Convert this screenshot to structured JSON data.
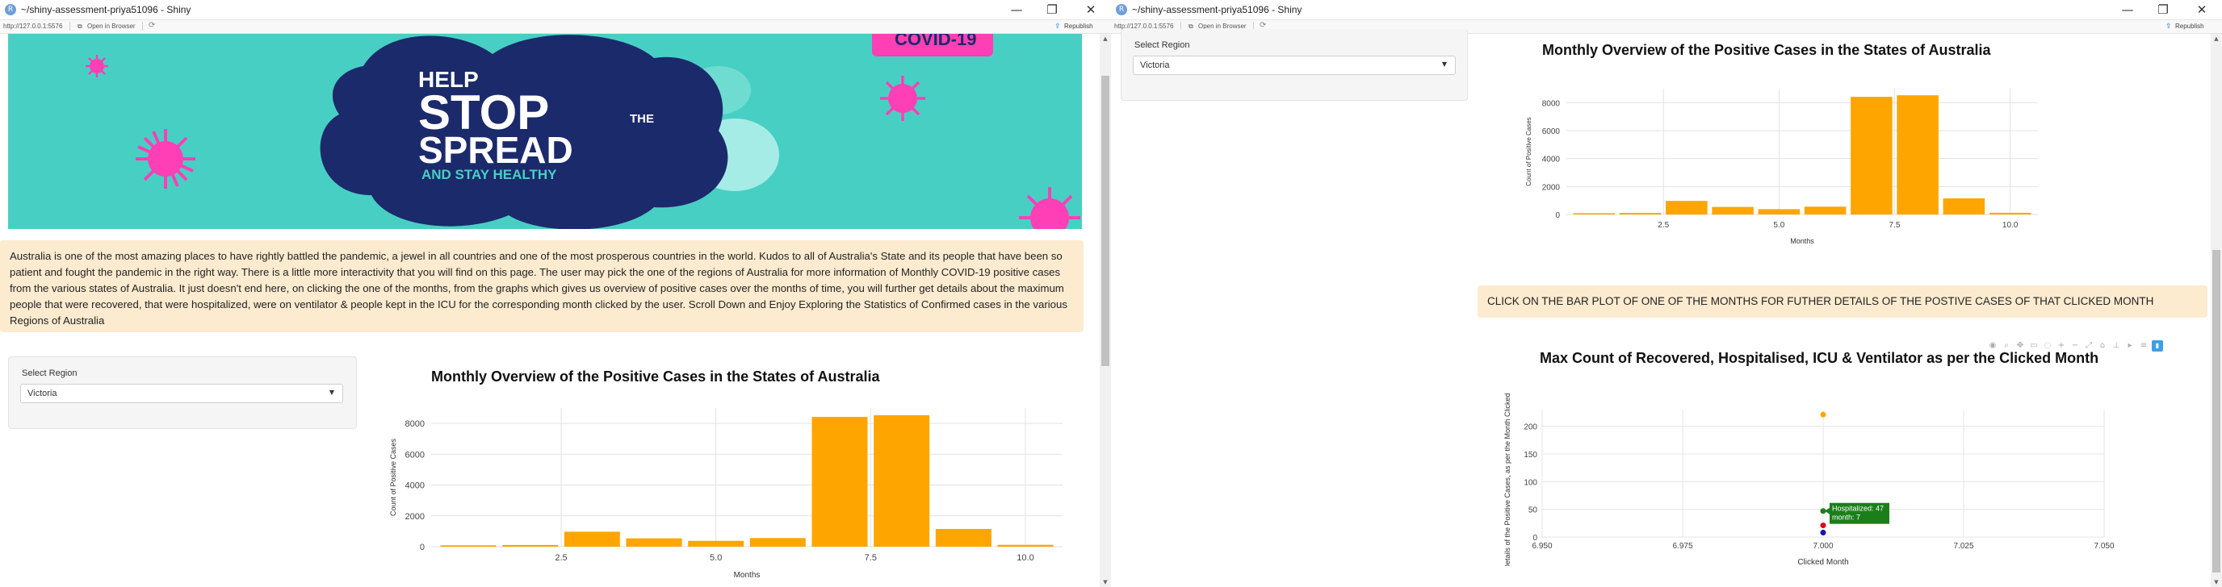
{
  "window": {
    "title": "~/shiny-assessment-priya51096 - Shiny",
    "url": "http://127.0.0.1:5576",
    "open_in_browser": "Open in Browser",
    "republish": "Republish",
    "minimize": "—",
    "maximize": "❐",
    "close": "✕"
  },
  "banner": {
    "line1": "HELP",
    "line2": "STOP",
    "the": "THE",
    "line3": "SPREAD",
    "line4": "AND STAY HEALTHY",
    "corner_text": "COVID-19",
    "bg_color": "#48cfc4",
    "blob_color": "#1b2a6b",
    "virus_color": "#ff3fb5"
  },
  "description": "Australia is one of the most amazing places to have rightly battled the pandemic, a jewel in all countries and one of the most prosperous countries in the world. Kudos to all of Australia's State and its people that have been so patient and fought the pandemic in the right way. There is a little more interactivity that you will find on this page. The user may pick the one of the regions of Australia for more information of Monthly COVID-19 positive cases from the various states of Australia. It just doesn't end here, on clicking the one of the months, from the graphs which gives us overview of positive cases over the months of time, you will further get details about the maximum people that were recovered, that were hospitalized, were on ventilator & people kept in the ICU for the corresponding month clicked by the user. Scroll Down and Enjoy Exploring the Statistics of Confirmed cases in the various Regions of Australia",
  "region_select": {
    "label": "Select Region",
    "value": "Victoria"
  },
  "click_instruction": "CLICK ON THE BAR PLOT OF ONE OF THE MONTHS FOR FUTHER DETAILS OF THE POSTIVE CASES OF THAT CLICKED MONTH",
  "modebar_icons": [
    "camera-icon",
    "zoom-icon",
    "pan-icon",
    "box-select-icon",
    "lasso-icon",
    "zoom-in-icon",
    "zoom-out-icon",
    "autoscale-icon",
    "reset-axes-icon",
    "spike-icon",
    "hover-closest-icon",
    "hover-compare-icon",
    "plotly-logo-icon"
  ],
  "tooltip": {
    "line1": "Hospitalized: 47",
    "line2": "month: 7"
  },
  "chart_data": [
    {
      "type": "bar",
      "title": "Monthly Overview of the Positive Cases in the States of Australia",
      "xlabel": "Months",
      "ylabel": "Count of Positive Cases",
      "x": [
        1,
        2,
        3,
        4,
        5,
        6,
        7,
        8,
        9,
        10
      ],
      "values": [
        90,
        110,
        970,
        540,
        380,
        560,
        8420,
        8530,
        1150,
        120
      ],
      "xlim": [
        0.4,
        10.6
      ],
      "ylim": [
        0,
        9000
      ],
      "xticks": [
        "2.5",
        "5.0",
        "7.5",
        "10.0"
      ],
      "xtick_values": [
        2.5,
        5.0,
        7.5,
        10.0
      ],
      "yticks": [
        "0",
        "2000",
        "4000",
        "6000",
        "8000"
      ],
      "ytick_values": [
        0,
        2000,
        4000,
        6000,
        8000
      ],
      "bar_color": "#ffa500",
      "grid": true
    },
    {
      "type": "scatter",
      "title": "Max Count of Recovered, Hospitalised, ICU & Ventilator as per the Clicked Month",
      "xlabel": "Clicked Month",
      "ylabel": "Details of the Positive Cases, as per the Month Clicked",
      "xlim": [
        6.95,
        7.05
      ],
      "ylim": [
        0,
        230
      ],
      "xticks": [
        "6.950",
        "6.975",
        "7.000",
        "7.025",
        "7.050"
      ],
      "xtick_values": [
        6.95,
        6.975,
        7.0,
        7.025,
        7.05
      ],
      "yticks": [
        "0",
        "50",
        "100",
        "150",
        "200"
      ],
      "ytick_values": [
        0,
        50,
        100,
        150,
        200
      ],
      "points": [
        {
          "x": 7,
          "y": 221,
          "color": "#ffa500"
        },
        {
          "x": 7,
          "y": 47,
          "color": "#1a7f1a"
        },
        {
          "x": 7,
          "y": 21,
          "color": "#e0001b"
        },
        {
          "x": 7,
          "y": 8,
          "color": "#1414b4"
        }
      ],
      "grid": true
    }
  ]
}
